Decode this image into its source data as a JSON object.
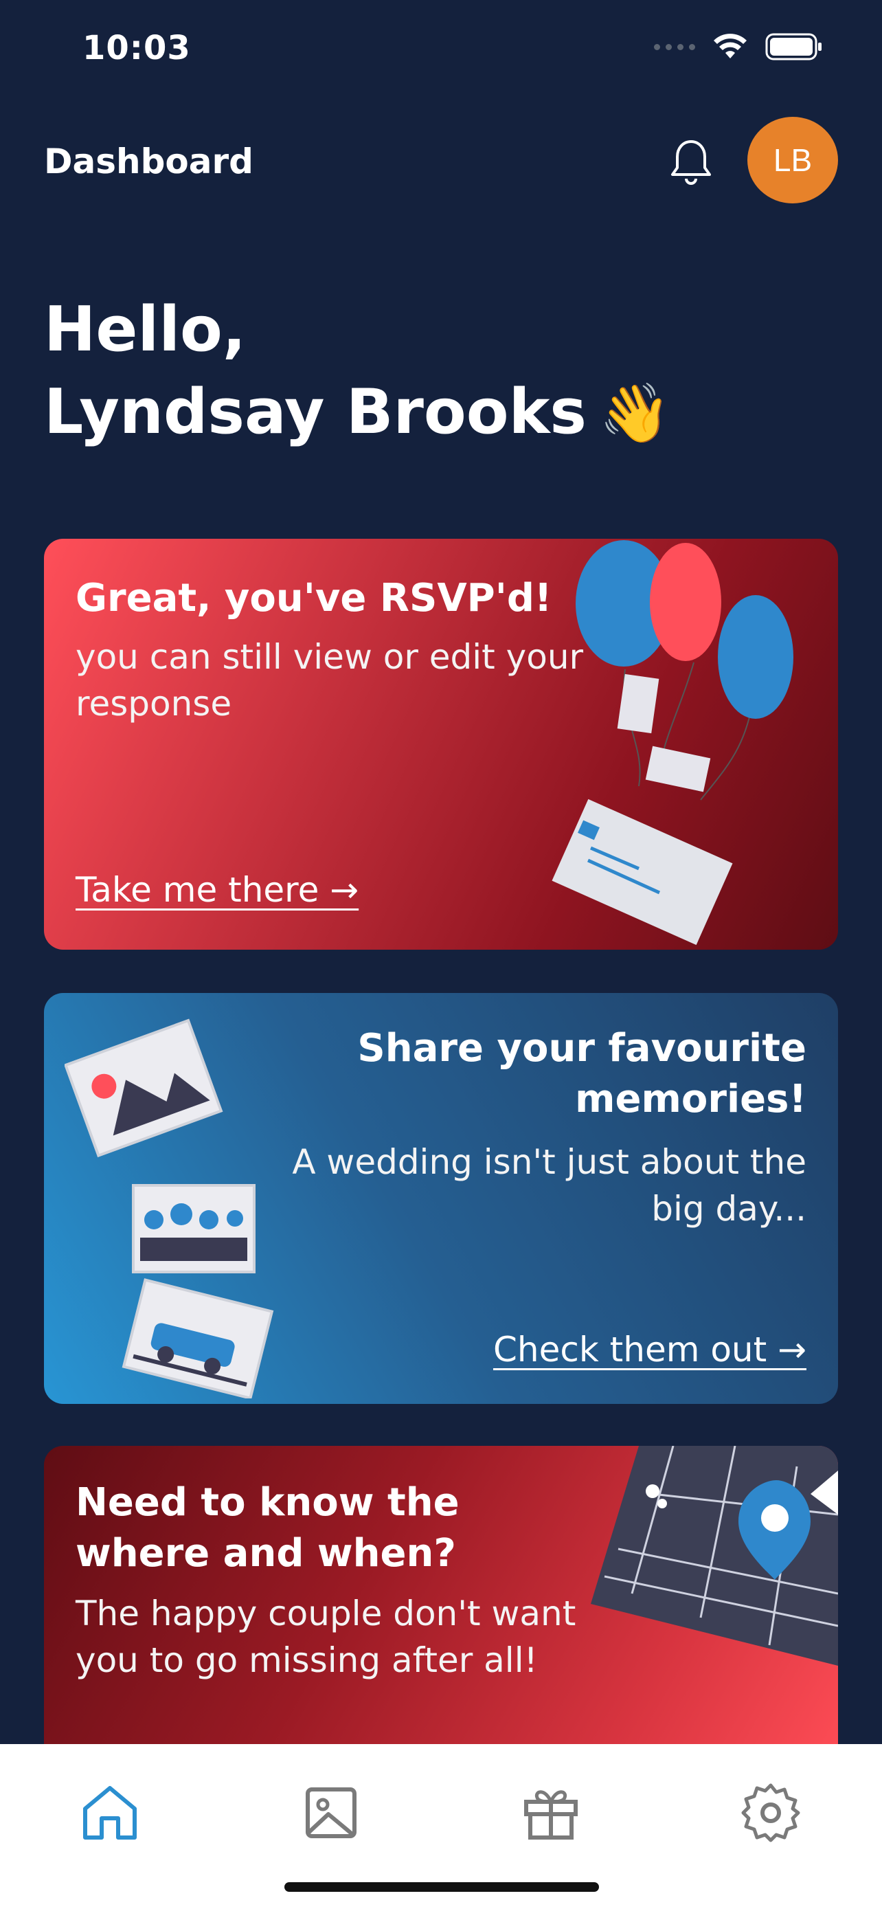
{
  "status_bar": {
    "time": "10:03"
  },
  "header": {
    "title": "Dashboard",
    "avatar_initials": "LB"
  },
  "greeting": {
    "line1": "Hello,",
    "line2": "Lyndsay Brooks",
    "emoji": "👋"
  },
  "cards": [
    {
      "title": "Great, you've RSVP'd!",
      "subtitle": "you can still view or edit your response",
      "link": "Take me there →"
    },
    {
      "title": "Share your favourite memories!",
      "subtitle": "A wedding isn't just about the big day...",
      "link": "Check them out →"
    },
    {
      "title": "Need to know the where and when?",
      "subtitle": "The happy couple don't want you to go missing after all!"
    }
  ],
  "tab_bar": {
    "items": [
      "home-icon",
      "image-icon",
      "gift-icon",
      "settings-icon"
    ],
    "active": "home-icon"
  },
  "colors": {
    "background": "#14213d",
    "avatar": "#e7822a",
    "tab_active": "#2b8fd0",
    "tab_inactive": "#7a7a7a"
  }
}
